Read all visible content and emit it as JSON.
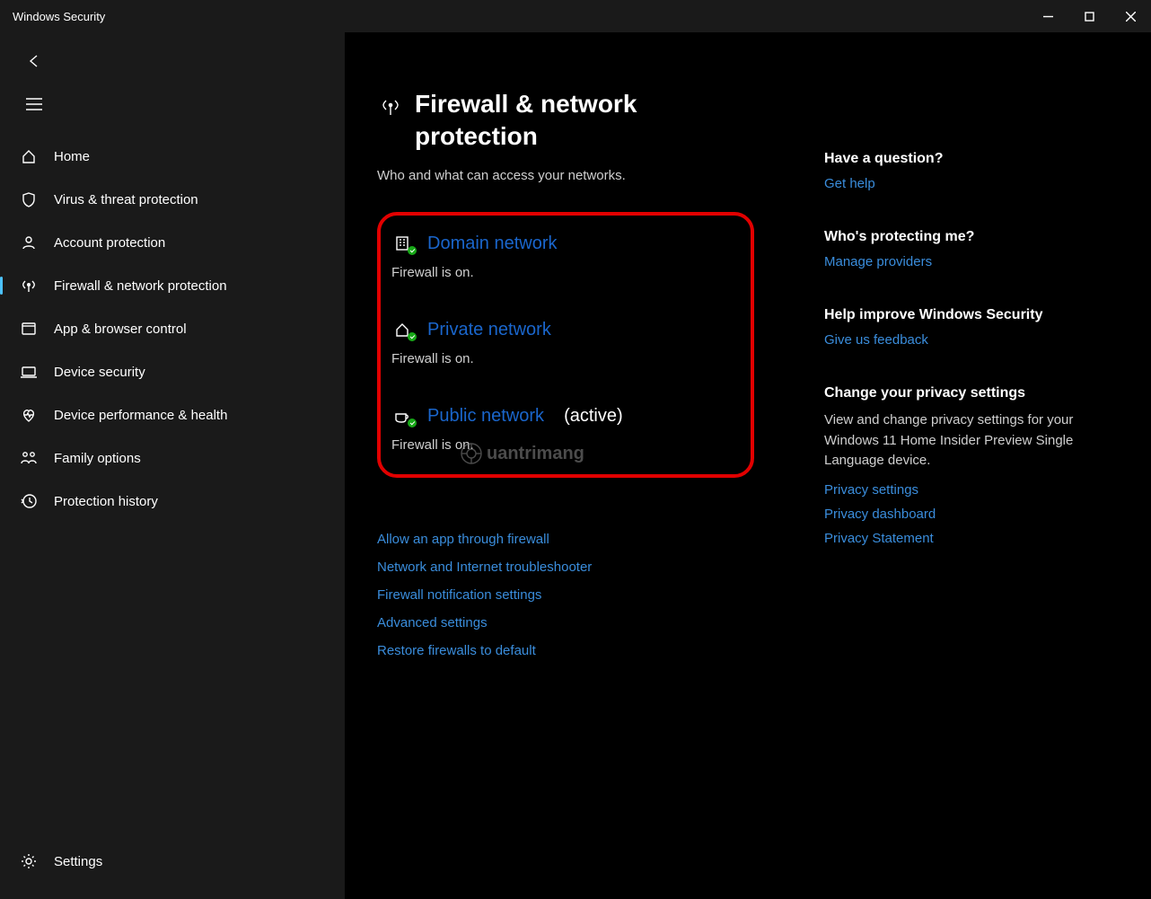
{
  "window": {
    "title": "Windows Security"
  },
  "sidebar": {
    "items": [
      {
        "label": "Home"
      },
      {
        "label": "Virus & threat protection"
      },
      {
        "label": "Account protection"
      },
      {
        "label": "Firewall & network protection"
      },
      {
        "label": "App & browser control"
      },
      {
        "label": "Device security"
      },
      {
        "label": "Device performance & health"
      },
      {
        "label": "Family options"
      },
      {
        "label": "Protection history"
      }
    ],
    "settings": "Settings"
  },
  "page": {
    "title": "Firewall & network protection",
    "subtitle": "Who and what can access your networks."
  },
  "networks": [
    {
      "label": "Domain network",
      "status": "Firewall is on.",
      "active": ""
    },
    {
      "label": "Private network",
      "status": "Firewall is on.",
      "active": ""
    },
    {
      "label": "Public network",
      "status": "Firewall is on.",
      "active": "(active)"
    }
  ],
  "fwlinks": [
    "Allow an app through firewall",
    "Network and Internet troubleshooter",
    "Firewall notification settings",
    "Advanced settings",
    "Restore firewalls to default"
  ],
  "aside": {
    "question": {
      "title": "Have a question?",
      "link": "Get help"
    },
    "protecting": {
      "title": "Who's protecting me?",
      "link": "Manage providers"
    },
    "improve": {
      "title": "Help improve Windows Security",
      "link": "Give us feedback"
    },
    "privacy": {
      "title": "Change your privacy settings",
      "desc": "View and change privacy settings for your Windows 11 Home Insider Preview Single Language device.",
      "links": [
        "Privacy settings",
        "Privacy dashboard",
        "Privacy Statement"
      ]
    }
  },
  "watermark": "uantrimang"
}
